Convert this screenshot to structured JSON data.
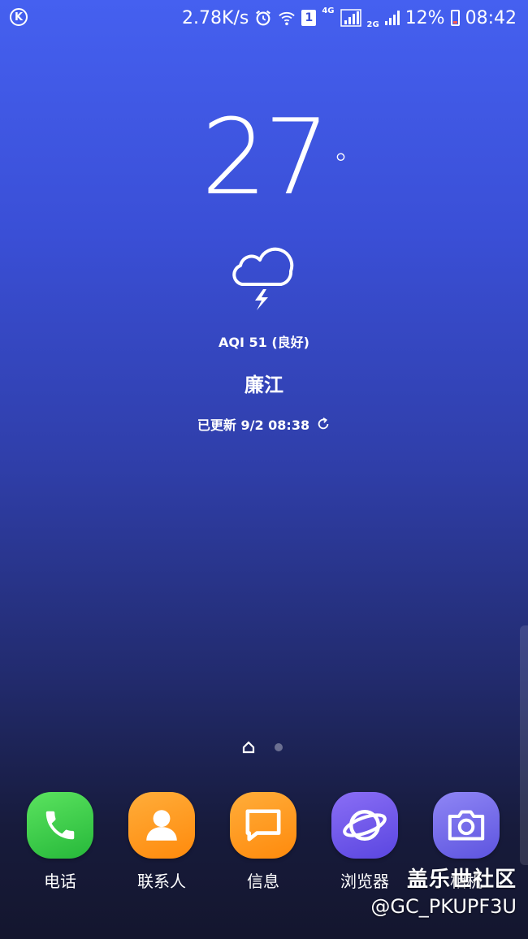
{
  "status_bar": {
    "network_speed": "2.78K/s",
    "sim_slot": "1",
    "net_4g": "4G",
    "net_2g": "2G",
    "battery_percent": "12%",
    "time": "08:42",
    "icons": [
      "k-app-icon",
      "alarm-icon",
      "wifi-icon",
      "sim-icon",
      "signal-icon",
      "battery-icon"
    ]
  },
  "weather": {
    "temperature": "27",
    "unit": "°",
    "condition_icon": "thunderstorm-icon",
    "aqi": "AQI 51 (良好)",
    "city": "廉江",
    "updated": "已更新 9/2 08:38"
  },
  "dock": {
    "apps": [
      {
        "label": "电话",
        "icon": "phone-icon",
        "color": "#3fd24a"
      },
      {
        "label": "联系人",
        "icon": "contacts-icon",
        "color": "#ff9a1f"
      },
      {
        "label": "信息",
        "icon": "messages-icon",
        "color": "#ff9a1f"
      },
      {
        "label": "浏览器",
        "icon": "browser-icon",
        "color": "#6b55e8"
      },
      {
        "label": "相机",
        "icon": "camera-icon",
        "color": "#7a6cf0"
      }
    ]
  },
  "watermark": {
    "brand": "盖乐世社区",
    "handle": "@GC_PKUPF3U"
  }
}
